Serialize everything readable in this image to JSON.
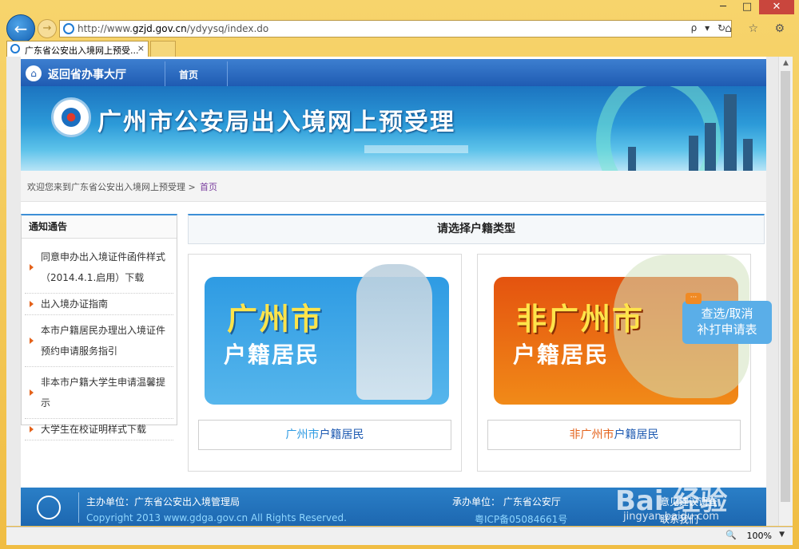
{
  "browser": {
    "url_prefix": "http://www.",
    "url_domain": "gzjd.gov.cn",
    "url_path": "/ydyysq/index.do",
    "tab_title": "广东省公安出入境网上预受...",
    "tab_close": "×",
    "zoom": "100%",
    "window_controls": {
      "minimize": "─",
      "maximize": "□",
      "close": "✕"
    },
    "nav": {
      "back": "←",
      "forward": "→"
    },
    "address_tools": "ρ ▾ ↻",
    "right_tools": "⌂ ☆ ⚙"
  },
  "site": {
    "nav": {
      "back_label": "返回省办事大厅",
      "home_label": "首页"
    },
    "banner_title": "广州市公安局出入境网上预受理",
    "breadcrumb": {
      "welcome": "欢迎您来到广东省公安出入境网上预受理 >",
      "current": "首页"
    },
    "notice": {
      "title": "通知通告",
      "items": [
        "同意申办出入境证件函件样式（2014.4.1.启用）下载",
        "出入境办证指南",
        "本市户籍居民办理出入境证件预约申请服务指引",
        "非本市户籍大学生申请温馨提示",
        "大学生在校证明样式下载"
      ]
    },
    "select_title": "请选择户籍类型",
    "cards": [
      {
        "img_big": "广州市",
        "img_small": "户籍居民",
        "btn_part1": "广州市",
        "btn_part2": "户籍居民"
      },
      {
        "img_big": "非广州市",
        "img_small": "户籍居民",
        "btn_part1": "非广州市",
        "btn_part2": "户籍居民"
      }
    ],
    "float_box": {
      "line1": "查选/取消",
      "line2": "补打申请表"
    },
    "footer": {
      "host": "主办单位：广东省公安出入境管理局",
      "copyright": "Copyright 2013 www.gdga.gov.cn All Rights Reserved.",
      "organizer": "承办单位： 广东省公安厅",
      "icp": "粤ICP备05084661号",
      "link1": "意见建议调查",
      "link2": "联系我们"
    },
    "watermark": {
      "logo": "Bai 经验",
      "url": "jingyan.baidu.com"
    }
  },
  "colors": {
    "brand_blue": "#1f5bb2",
    "accent_orange": "#e4621b",
    "link_purple": "#7a3e9e"
  }
}
